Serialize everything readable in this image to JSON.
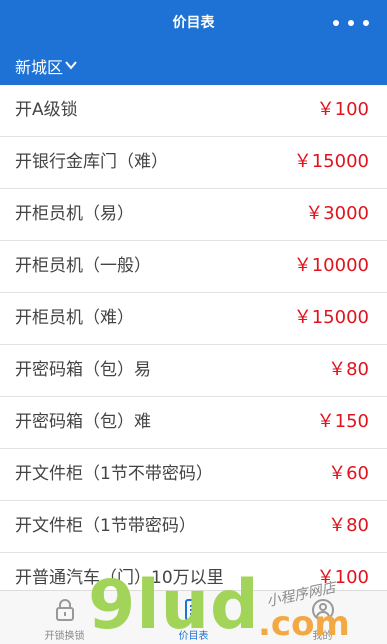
{
  "header": {
    "title": "价目表"
  },
  "district": {
    "label": "新城区"
  },
  "price_list": [
    {
      "name": "开A级锁",
      "price": "￥100"
    },
    {
      "name": "开银行金库门（难）",
      "price": "￥15000"
    },
    {
      "name": "开柜员机（易）",
      "price": "￥3000"
    },
    {
      "name": "开柜员机（一般）",
      "price": "￥10000"
    },
    {
      "name": "开柜员机（难）",
      "price": "￥15000"
    },
    {
      "name": "开密码箱（包）易",
      "price": "￥80"
    },
    {
      "name": "开密码箱（包）难",
      "price": "￥150"
    },
    {
      "name": "开文件柜（1节不带密码）",
      "price": "￥60"
    },
    {
      "name": "开文件柜（1节带密码）",
      "price": "￥80"
    },
    {
      "name": "开普通汽车（门）10万以里",
      "price": "￥100"
    }
  ],
  "tabbar": {
    "tabs": [
      {
        "label": "开锁换锁",
        "icon": "lock-icon"
      },
      {
        "label": "价目表",
        "icon": "price-list-icon"
      },
      {
        "label": "我的",
        "icon": "profile-icon"
      }
    ],
    "active": "价目表"
  },
  "watermark": {
    "main": "9lud",
    "domain": ".com",
    "sub": "小程序网店"
  },
  "colors": {
    "brand": "#1e72d6",
    "price": "#e0141e"
  }
}
